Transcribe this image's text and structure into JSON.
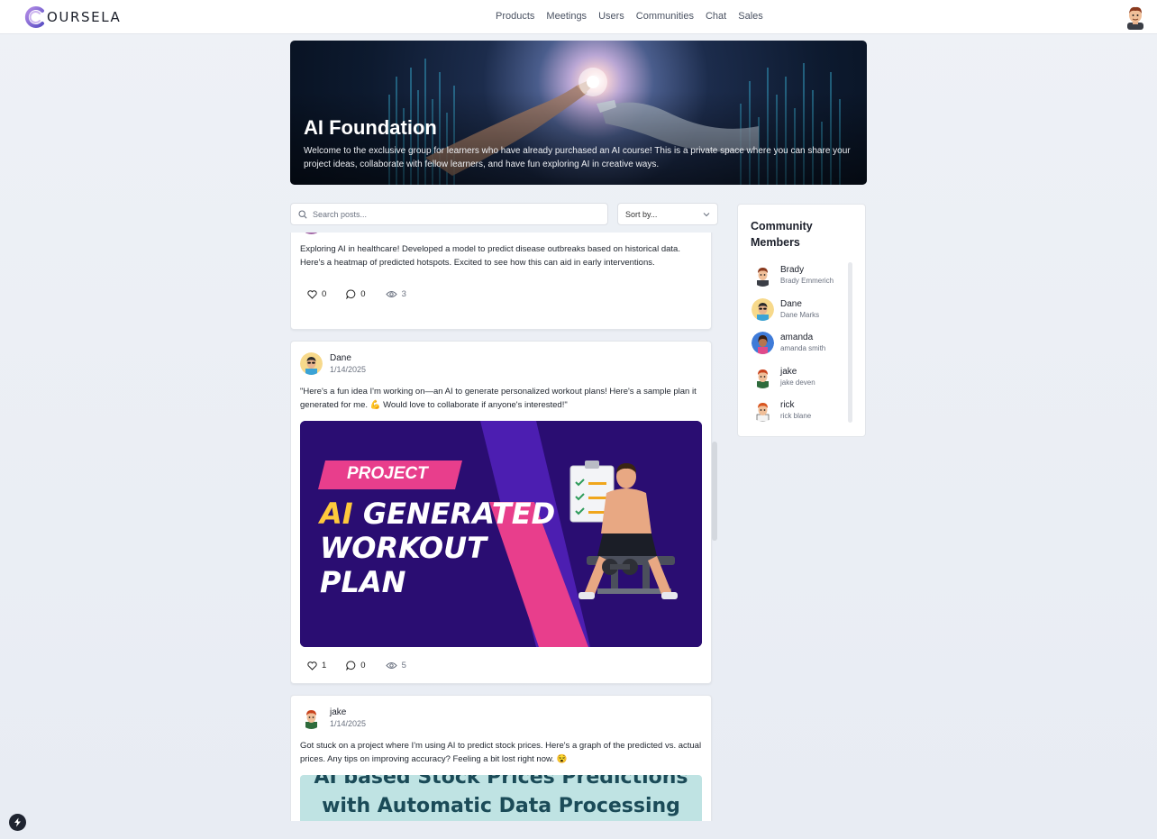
{
  "app": {
    "logo_text": "OURSELA"
  },
  "nav": {
    "items": [
      "Products",
      "Meetings",
      "Users",
      "Communities",
      "Chat",
      "Sales"
    ]
  },
  "hero": {
    "title": "AI Foundation",
    "description": "Welcome to the exclusive group for learners who have already purchased an AI course! This is a private space where you can share your project ideas, collaborate with fellow learners, and have fun exploring AI in creative ways."
  },
  "search": {
    "placeholder": "Search posts..."
  },
  "sort": {
    "label": "Sort by..."
  },
  "posts": [
    {
      "text": "Exploring AI in healthcare! Developed a model to predict disease outbreaks based on historical data. Here's a heatmap of predicted hotspots. Excited to see how this can aid in early interventions.",
      "likes": "0",
      "comments": "0",
      "views": "3"
    },
    {
      "author": "Dane",
      "date": "1/14/2025",
      "text": "\"Here's a fun idea I'm working on—an AI to generate personalized workout plans! Here's a sample plan it generated for me. 💪 Would love to collaborate if anyone's interested!\"",
      "image": {
        "tag": "PROJECT",
        "line1_accent": "AI",
        "line1_rest": "GENERATED",
        "line2": "WORKOUT",
        "line3": "PLAN"
      },
      "likes": "1",
      "comments": "0",
      "views": "5"
    },
    {
      "author": "jake",
      "date": "1/14/2025",
      "text": "Got stuck on a project where I'm using AI to predict stock prices. Here's a graph of the predicted vs. actual prices. Any tips on improving accuracy? Feeling a bit lost right now. 😵",
      "image": {
        "line1": "AI based Stock Prices Predictions",
        "line2": "with Automatic Data Processing"
      }
    }
  ],
  "members": {
    "title": "Community Members",
    "list": [
      {
        "name": "Brady",
        "full": "Brady Emmerich"
      },
      {
        "name": "Dane",
        "full": "Dane Marks"
      },
      {
        "name": "amanda",
        "full": "amanda smith"
      },
      {
        "name": "jake",
        "full": "jake deven"
      },
      {
        "name": "rick",
        "full": "rick blane"
      }
    ]
  },
  "colors": {
    "accent": "#7b5cd6",
    "workout_bg": "#2a0d72",
    "workout_pink": "#e83e8c",
    "stock_bg": "#bfe3e3"
  }
}
